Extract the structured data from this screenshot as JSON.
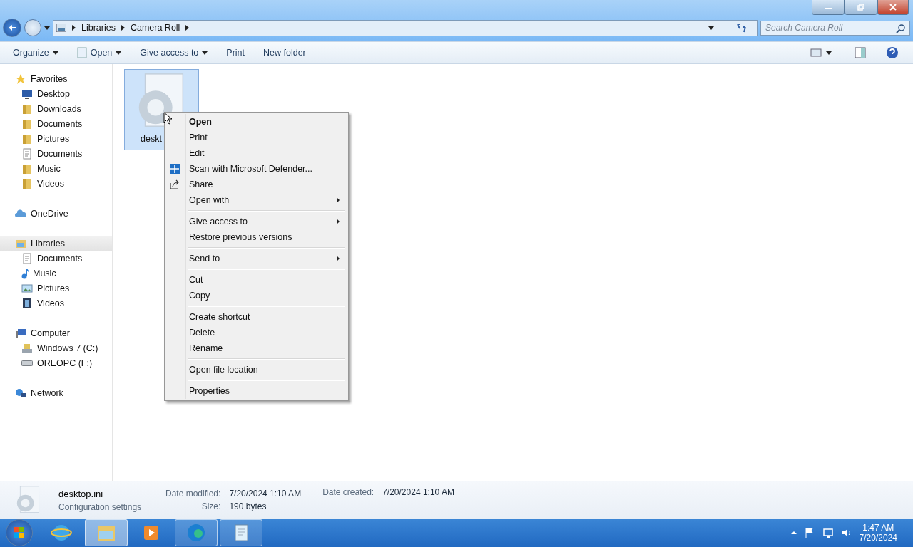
{
  "address_bar": {
    "breadcrumbs": [
      "Libraries",
      "Camera Roll"
    ]
  },
  "search": {
    "placeholder": "Search Camera Roll"
  },
  "toolbar": [
    {
      "label": "Organize",
      "dropdown": true,
      "kind": "text"
    },
    {
      "label": "Open",
      "dropdown": true,
      "kind": "notepad"
    },
    {
      "label": "Give access to",
      "dropdown": true,
      "kind": "text"
    },
    {
      "label": "Print",
      "dropdown": false,
      "kind": "text"
    },
    {
      "label": "New folder",
      "dropdown": false,
      "kind": "text"
    }
  ],
  "nav_pane": [
    {
      "label": "Favorites",
      "kind": "star",
      "selected": false,
      "children": [
        {
          "label": "Desktop",
          "kind": "desktop"
        },
        {
          "label": "Downloads",
          "kind": "folder"
        },
        {
          "label": "Documents",
          "kind": "folder"
        },
        {
          "label": "Pictures",
          "kind": "folder"
        },
        {
          "label": "Documents",
          "kind": "doc"
        },
        {
          "label": "Music",
          "kind": "folder"
        },
        {
          "label": "Videos",
          "kind": "folder"
        }
      ]
    },
    {
      "label": "OneDrive",
      "kind": "cloud",
      "selected": false
    },
    {
      "label": "Libraries",
      "kind": "library",
      "selected": true,
      "children": [
        {
          "label": "Documents",
          "kind": "doc"
        },
        {
          "label": "Music",
          "kind": "note"
        },
        {
          "label": "Pictures",
          "kind": "image"
        },
        {
          "label": "Videos",
          "kind": "film"
        }
      ]
    },
    {
      "label": "Computer",
      "kind": "computer",
      "selected": false,
      "children": [
        {
          "label": "Windows 7 (C:)",
          "kind": "drive"
        },
        {
          "label": "OREOPC (F:)",
          "kind": "usb"
        }
      ]
    },
    {
      "label": "Network",
      "kind": "network",
      "selected": false
    }
  ],
  "files": [
    {
      "name": "deskt",
      "selected": true
    }
  ],
  "context_menu": {
    "groups": [
      [
        {
          "label": "Open",
          "default": true,
          "submenu": false,
          "kind": "plain"
        },
        {
          "label": "Print",
          "default": false,
          "submenu": false,
          "kind": "plain"
        },
        {
          "label": "Edit",
          "default": false,
          "submenu": false,
          "kind": "plain"
        },
        {
          "label": "Scan with Microsoft Defender...",
          "default": false,
          "submenu": false,
          "kind": "shield"
        },
        {
          "label": "Share",
          "default": false,
          "submenu": false,
          "kind": "share"
        },
        {
          "label": "Open with",
          "default": false,
          "submenu": true,
          "kind": "plain"
        }
      ],
      [
        {
          "label": "Give access to",
          "default": false,
          "submenu": true,
          "kind": "plain"
        },
        {
          "label": "Restore previous versions",
          "default": false,
          "submenu": false,
          "kind": "plain"
        }
      ],
      [
        {
          "label": "Send to",
          "default": false,
          "submenu": true,
          "kind": "plain"
        }
      ],
      [
        {
          "label": "Cut",
          "default": false,
          "submenu": false,
          "kind": "plain"
        },
        {
          "label": "Copy",
          "default": false,
          "submenu": false,
          "kind": "plain"
        }
      ],
      [
        {
          "label": "Create shortcut",
          "default": false,
          "submenu": false,
          "kind": "plain"
        },
        {
          "label": "Delete",
          "default": false,
          "submenu": false,
          "kind": "plain"
        },
        {
          "label": "Rename",
          "default": false,
          "submenu": false,
          "kind": "plain"
        }
      ],
      [
        {
          "label": "Open file location",
          "default": false,
          "submenu": false,
          "kind": "plain"
        }
      ],
      [
        {
          "label": "Properties",
          "default": false,
          "submenu": false,
          "kind": "plain"
        }
      ]
    ]
  },
  "details": {
    "name": "desktop.ini",
    "type": "Configuration settings",
    "fields": [
      {
        "label": "Date modified:",
        "value": "7/20/2024 1:10 AM"
      },
      {
        "label": "Size:",
        "value": "190 bytes"
      },
      {
        "label": "Date created:",
        "value": "7/20/2024 1:10 AM"
      }
    ]
  },
  "taskbar": {
    "apps": [
      {
        "kind": "ie",
        "running": false,
        "active": false
      },
      {
        "kind": "explorer",
        "running": true,
        "active": true
      },
      {
        "kind": "media",
        "running": false,
        "active": false
      },
      {
        "kind": "edge",
        "running": true,
        "active": false
      },
      {
        "kind": "notepad",
        "running": true,
        "active": false
      }
    ],
    "clock": {
      "time": "1:47 AM",
      "date": "7/20/2024"
    }
  }
}
